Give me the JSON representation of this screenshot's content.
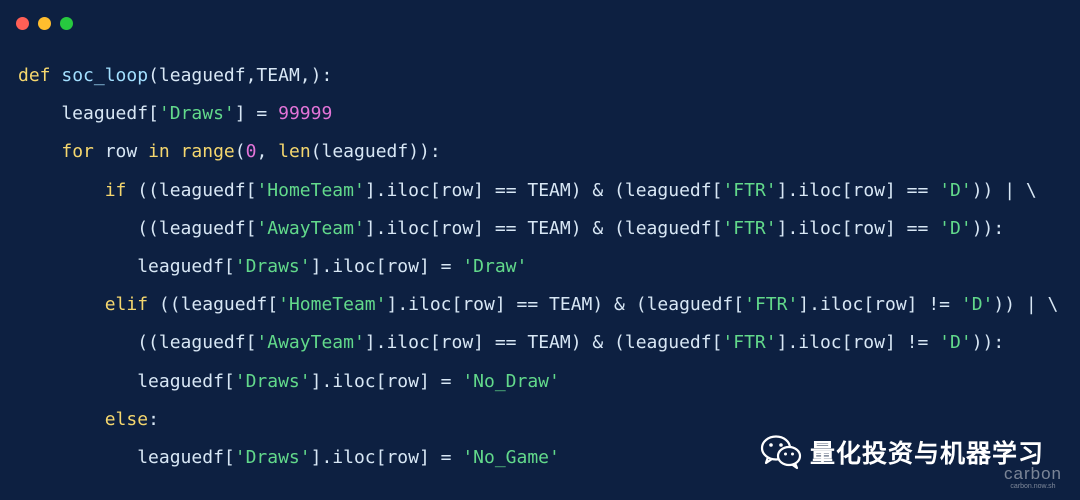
{
  "window": {
    "controls": [
      "close",
      "minimize",
      "maximize"
    ]
  },
  "code": {
    "lines": [
      [
        {
          "t": "def",
          "c": "kw"
        },
        {
          "t": " soc_loop",
          "c": "fn"
        },
        {
          "t": "(leaguedf,TEAM,):",
          "c": "plain"
        }
      ],
      [
        {
          "t": "    leaguedf[",
          "c": "plain"
        },
        {
          "t": "'Draws'",
          "c": "str"
        },
        {
          "t": "] = ",
          "c": "plain"
        },
        {
          "t": "99999",
          "c": "num"
        }
      ],
      [
        {
          "t": "    ",
          "c": "plain"
        },
        {
          "t": "for",
          "c": "kw"
        },
        {
          "t": " row ",
          "c": "plain"
        },
        {
          "t": "in",
          "c": "kw"
        },
        {
          "t": " range",
          "c": "kw"
        },
        {
          "t": "(",
          "c": "plain"
        },
        {
          "t": "0",
          "c": "num"
        },
        {
          "t": ", ",
          "c": "plain"
        },
        {
          "t": "len",
          "c": "kw"
        },
        {
          "t": "(leaguedf)):",
          "c": "plain"
        }
      ],
      [
        {
          "t": "        ",
          "c": "plain"
        },
        {
          "t": "if",
          "c": "kw"
        },
        {
          "t": " ((leaguedf[",
          "c": "plain"
        },
        {
          "t": "'HomeTeam'",
          "c": "str"
        },
        {
          "t": "].iloc[row] == TEAM) & (leaguedf[",
          "c": "plain"
        },
        {
          "t": "'FTR'",
          "c": "str"
        },
        {
          "t": "].iloc[row] == ",
          "c": "plain"
        },
        {
          "t": "'D'",
          "c": "str"
        },
        {
          "t": ")) | \\",
          "c": "plain"
        }
      ],
      [
        {
          "t": "           ((leaguedf[",
          "c": "plain"
        },
        {
          "t": "'AwayTeam'",
          "c": "str"
        },
        {
          "t": "].iloc[row] == TEAM) & (leaguedf[",
          "c": "plain"
        },
        {
          "t": "'FTR'",
          "c": "str"
        },
        {
          "t": "].iloc[row] == ",
          "c": "plain"
        },
        {
          "t": "'D'",
          "c": "str"
        },
        {
          "t": ")):",
          "c": "plain"
        }
      ],
      [
        {
          "t": "           leaguedf[",
          "c": "plain"
        },
        {
          "t": "'Draws'",
          "c": "str"
        },
        {
          "t": "].iloc[row] = ",
          "c": "plain"
        },
        {
          "t": "'Draw'",
          "c": "str"
        }
      ],
      [
        {
          "t": "        ",
          "c": "plain"
        },
        {
          "t": "elif",
          "c": "kw"
        },
        {
          "t": " ((leaguedf[",
          "c": "plain"
        },
        {
          "t": "'HomeTeam'",
          "c": "str"
        },
        {
          "t": "].iloc[row] == TEAM) & (leaguedf[",
          "c": "plain"
        },
        {
          "t": "'FTR'",
          "c": "str"
        },
        {
          "t": "].iloc[row] != ",
          "c": "plain"
        },
        {
          "t": "'D'",
          "c": "str"
        },
        {
          "t": ")) | \\",
          "c": "plain"
        }
      ],
      [
        {
          "t": "           ((leaguedf[",
          "c": "plain"
        },
        {
          "t": "'AwayTeam'",
          "c": "str"
        },
        {
          "t": "].iloc[row] == TEAM) & (leaguedf[",
          "c": "plain"
        },
        {
          "t": "'FTR'",
          "c": "str"
        },
        {
          "t": "].iloc[row] != ",
          "c": "plain"
        },
        {
          "t": "'D'",
          "c": "str"
        },
        {
          "t": ")):",
          "c": "plain"
        }
      ],
      [
        {
          "t": "           leaguedf[",
          "c": "plain"
        },
        {
          "t": "'Draws'",
          "c": "str"
        },
        {
          "t": "].iloc[row] = ",
          "c": "plain"
        },
        {
          "t": "'No_Draw'",
          "c": "str"
        }
      ],
      [
        {
          "t": "        ",
          "c": "plain"
        },
        {
          "t": "else",
          "c": "kw"
        },
        {
          "t": ":",
          "c": "plain"
        }
      ],
      [
        {
          "t": "           leaguedf[",
          "c": "plain"
        },
        {
          "t": "'Draws'",
          "c": "str"
        },
        {
          "t": "].iloc[row] = ",
          "c": "plain"
        },
        {
          "t": "'No_Game'",
          "c": "str"
        }
      ]
    ]
  },
  "watermark": {
    "text": "量化投资与机器学习",
    "icon": "wechat-icon"
  },
  "branding": {
    "carbon": "carbon",
    "carbon_url": "carbon.now.sh"
  },
  "colors": {
    "background": "#0d2041",
    "keyword": "#f5d76e",
    "string": "#62d98b",
    "number": "#e374d8",
    "text": "#d8e7f5"
  }
}
